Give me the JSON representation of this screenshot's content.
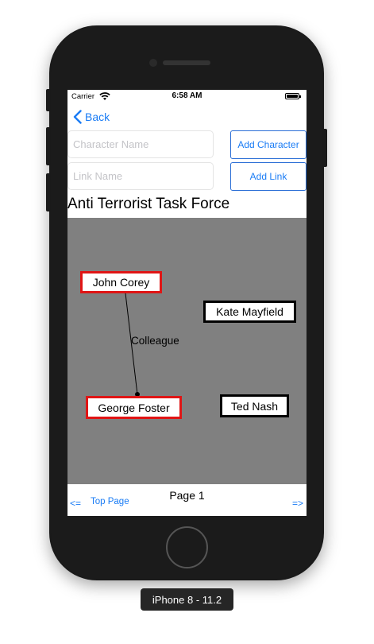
{
  "status_bar": {
    "carrier": "Carrier",
    "time": "6:58 AM",
    "wifi_icon": "wifi-icon",
    "battery_icon": "battery-full-icon"
  },
  "nav": {
    "back_label": "Back",
    "back_icon": "chevron-left-icon"
  },
  "form": {
    "character_placeholder": "Character Name",
    "character_value": "",
    "link_placeholder": "Link Name",
    "link_value": "",
    "add_character_label": "Add Character",
    "add_link_label": "Add Link"
  },
  "board": {
    "title": "Anti Terrorist Task Force",
    "characters": [
      {
        "name": "John Corey",
        "selected": true
      },
      {
        "name": "Kate Mayfield",
        "selected": false
      },
      {
        "name": "George Foster",
        "selected": true
      },
      {
        "name": "Ted Nash",
        "selected": false
      }
    ],
    "links": [
      {
        "from": "John Corey",
        "to": "George Foster",
        "label": "Colleague"
      }
    ]
  },
  "footer": {
    "prev_label": "<=",
    "top_page_label": "Top Page",
    "page_label": "Page 1",
    "next_label": "=>"
  },
  "device": {
    "label": "iPhone 8 - 11.2"
  },
  "colors": {
    "accent": "#1a7cf5",
    "canvas_bg": "#808080",
    "selected_border": "#e01515",
    "node_border": "#000000"
  }
}
